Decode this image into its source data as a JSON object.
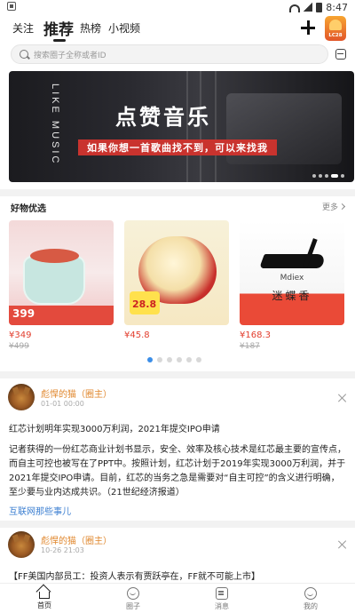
{
  "status_bar": {
    "time": "8:47"
  },
  "top_nav": {
    "tabs": [
      "关注",
      "推荐",
      "热榜",
      "小视频"
    ],
    "avatar_badge": "LC28"
  },
  "search": {
    "placeholder": "搜索圈子全称或者ID"
  },
  "banner": {
    "vertical_text": "LIKE MUSIC",
    "title": "点赞音乐",
    "subtitle": "如果你想一首歌曲找不到，可以来找我"
  },
  "goods": {
    "section_title": "好物优选",
    "more_label": "更多",
    "products": [
      {
        "price": "¥349",
        "old_price": "¥499",
        "image_badge": "399"
      },
      {
        "price": "¥45.8",
        "old_price": "",
        "image_badge": "28.8"
      },
      {
        "price": "¥168.3",
        "old_price": "¥187",
        "brand": "Mdiex",
        "name": "迷蝶香"
      }
    ]
  },
  "posts": [
    {
      "author": "彪悍的猫（圈主）",
      "time": "01-01 00:00",
      "title": "红芯计划明年实现3000万利润，2021年提交IPO申请",
      "body": "记者获得的一份红芯商业计划书显示，安全、效率及核心技术是红芯最主要的宣传点，而自主可控也被写在了PPT中。按照计划，红芯计划于2019年实现3000万利润，并于2021年提交IPO申请。目前，红芯的当务之急是需要对“自主可控”的含义进行明确，至少要与业内达成共识。（21世纪经济报道）",
      "tag": "互联网那些事儿"
    },
    {
      "author": "彪悍的猫（圈主）",
      "time": "10-26 21:03",
      "title": "【FF美国内部员工：投资人表示有贾跃亭在，FF就不可能上市】"
    }
  ],
  "tab_bar": {
    "items": [
      "首页",
      "圈子",
      "消息",
      "我的"
    ]
  },
  "colors": {
    "accent_orange": "#e0872d",
    "price_red": "#e23d2d",
    "link_blue": "#3c7fd1"
  }
}
